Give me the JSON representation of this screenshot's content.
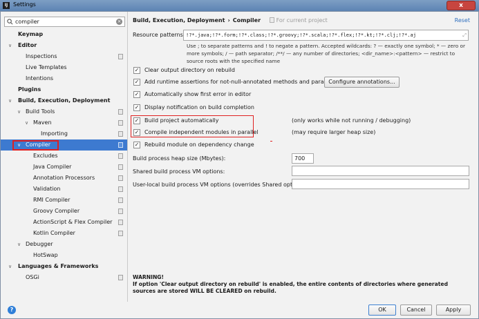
{
  "window": {
    "title": "Settings",
    "app_icon": "IJ",
    "close_label": "x"
  },
  "search": {
    "value": "compiler",
    "icon": "search-icon",
    "clear_icon": "clear-icon"
  },
  "tree": [
    {
      "label": "Keymap",
      "arrow": ""
    },
    {
      "label": "Editor",
      "arrow": "∨"
    },
    {
      "label": "Inspections",
      "arrow": ""
    },
    {
      "label": "Live Templates",
      "arrow": ""
    },
    {
      "label": "Intentions",
      "arrow": ""
    },
    {
      "label": "Plugins",
      "arrow": ""
    },
    {
      "label": "Build, Execution, Deployment",
      "arrow": "∨"
    },
    {
      "label": "Build Tools",
      "arrow": "∨"
    },
    {
      "label": "Maven",
      "arrow": "∨"
    },
    {
      "label": "Importing",
      "arrow": ""
    },
    {
      "label": "Compiler",
      "arrow": "∨"
    },
    {
      "label": "Excludes",
      "arrow": ""
    },
    {
      "label": "Java Compiler",
      "arrow": ""
    },
    {
      "label": "Annotation Processors",
      "arrow": ""
    },
    {
      "label": "Validation",
      "arrow": ""
    },
    {
      "label": "RMI Compiler",
      "arrow": ""
    },
    {
      "label": "Groovy Compiler",
      "arrow": ""
    },
    {
      "label": "ActionScript & Flex Compiler",
      "arrow": ""
    },
    {
      "label": "Kotlin Compiler",
      "arrow": ""
    },
    {
      "label": "Debugger",
      "arrow": "∨"
    },
    {
      "label": "HotSwap",
      "arrow": ""
    },
    {
      "label": "Languages & Frameworks",
      "arrow": "∨"
    },
    {
      "label": "OSGi",
      "arrow": ""
    }
  ],
  "breadcrumb": {
    "parent": "Build, Execution, Deployment",
    "separator": "›",
    "current": "Compiler",
    "scope": "For current project"
  },
  "reset_label": "Reset",
  "resource_patterns": {
    "label": "Resource patterns:",
    "value": "!?*.java;!?*.form;!?*.class;!?*.groovy;!?*.scala;!?*.flex;!?*.kt;!?*.clj;!?*.aj",
    "help": "Use ; to separate patterns and ! to negate a pattern. Accepted wildcards: ? — exactly one symbol; * — zero or more symbols; / — path separator; /**/ — any number of directories; <dir_name>:<pattern> — restrict to source roots with the specified name"
  },
  "checkboxes": [
    {
      "label": "Clear output directory on rebuild",
      "checked": true
    },
    {
      "label": "Add runtime assertions for not-null-annotated methods and parameters",
      "checked": true
    },
    {
      "label": "Automatically show first error in editor",
      "checked": true
    },
    {
      "label": "Display notification on build completion",
      "checked": true
    },
    {
      "label": "Build project automatically",
      "checked": true,
      "note": "(only works while not running / debugging)"
    },
    {
      "label": "Compile independent modules in parallel",
      "checked": true,
      "note": "(may require larger heap size)"
    },
    {
      "label": "Rebuild module on dependency change",
      "checked": true
    }
  ],
  "configure_button": "Configure annotations...",
  "fields": {
    "heap_label": "Build process heap size (Mbytes):",
    "heap_value": "700",
    "shared_vm_label": "Shared build process VM options:",
    "shared_vm_value": "",
    "user_vm_label": "User-local build process VM options (overrides Shared options):",
    "user_vm_value": ""
  },
  "warning": {
    "title": "WARNING!",
    "text": "If option 'Clear output directory on rebuild' is enabled, the entire contents of directories where generated sources are stored WILL BE CLEARED on rebuild."
  },
  "buttons": {
    "ok": "OK",
    "cancel": "Cancel",
    "apply": "Apply",
    "help": "?"
  },
  "colors": {
    "selection": "#3d7ad0",
    "highlight_box": "#e02020",
    "link": "#2f6fbf"
  }
}
